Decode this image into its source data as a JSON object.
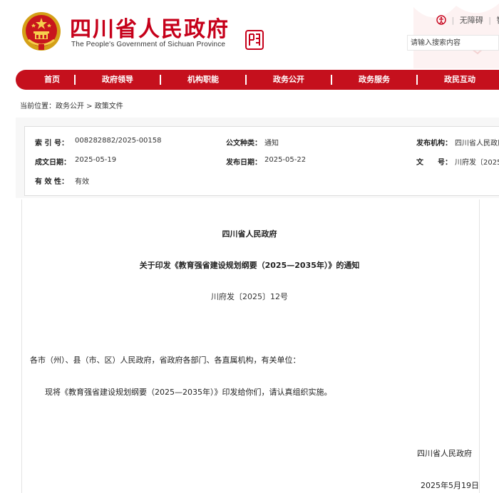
{
  "header": {
    "title": "四川省人民政府",
    "subtitle": "The People's Government of Sichuan Province",
    "links": [
      "无障碍",
      "智"
    ],
    "search_placeholder": "请输入搜索内容",
    "brand_color": "#c6001a"
  },
  "nav": {
    "items": [
      "首页",
      "政府领导",
      "机构职能",
      "政务公开",
      "政务服务",
      "政民互动"
    ],
    "bar_color": "#c5101d"
  },
  "breadcrumb": {
    "prefix": "当前位置：",
    "path": "政务公开 > 政策文件"
  },
  "meta": {
    "index_label": "索 引 号：",
    "index_value": "008282882/2025-00158",
    "category_label": "公文种类：",
    "category_value": "通知",
    "publisher_label": "发布机构：",
    "publisher_value": "四川省人民政府",
    "created_label": "成文日期：",
    "created_value": "2025-05-19",
    "published_label": "发布日期：",
    "published_value": "2025-05-22",
    "docno_label": "文　　号：",
    "docno_value": "川府发〔2025",
    "validity_label": "有 效 性：",
    "validity_value": "有效"
  },
  "document": {
    "org": "四川省人民政府",
    "title": "关于印发《教育强省建设规划纲要（2025—2035年）》的通知",
    "number": "川府发〔2025〕12号",
    "recipients": "各市（州）、县（市、区）人民政府，省政府各部门、各直属机构，有关单位：",
    "body": "现将《教育强省建设规划纲要（2025—2035年）》印发给你们，请认真组织实施。",
    "sign_org": "四川省人民政府",
    "sign_date": "2025年5月19日"
  }
}
